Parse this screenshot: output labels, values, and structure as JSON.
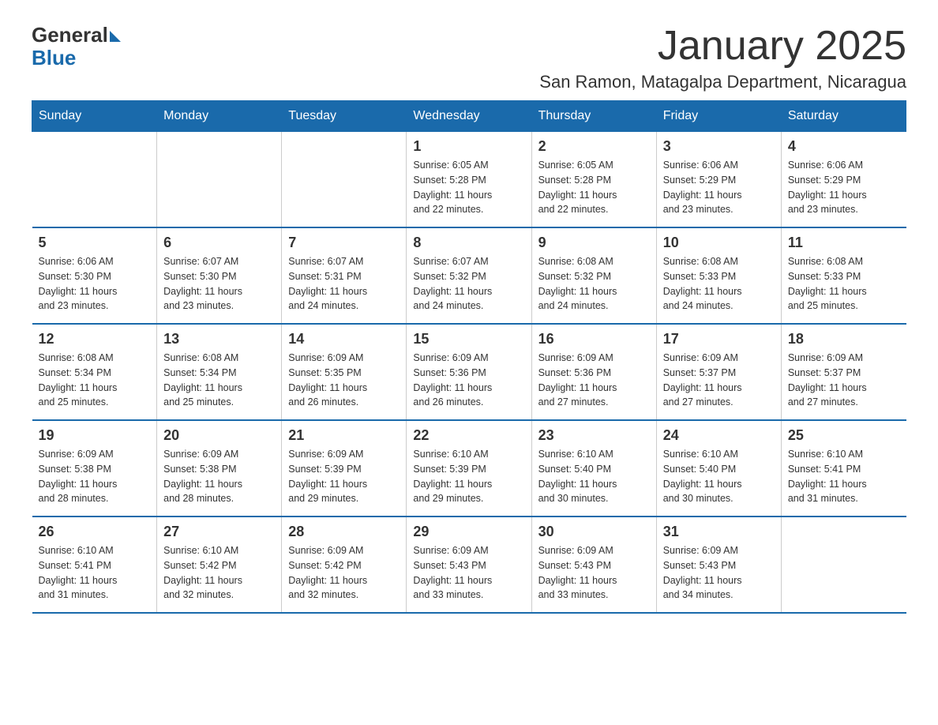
{
  "header": {
    "logo_general": "General",
    "logo_blue": "Blue",
    "month_year": "January 2025",
    "location": "San Ramon, Matagalpa Department, Nicaragua"
  },
  "days_of_week": [
    "Sunday",
    "Monday",
    "Tuesday",
    "Wednesday",
    "Thursday",
    "Friday",
    "Saturday"
  ],
  "weeks": [
    [
      {
        "day": "",
        "info": ""
      },
      {
        "day": "",
        "info": ""
      },
      {
        "day": "",
        "info": ""
      },
      {
        "day": "1",
        "info": "Sunrise: 6:05 AM\nSunset: 5:28 PM\nDaylight: 11 hours\nand 22 minutes."
      },
      {
        "day": "2",
        "info": "Sunrise: 6:05 AM\nSunset: 5:28 PM\nDaylight: 11 hours\nand 22 minutes."
      },
      {
        "day": "3",
        "info": "Sunrise: 6:06 AM\nSunset: 5:29 PM\nDaylight: 11 hours\nand 23 minutes."
      },
      {
        "day": "4",
        "info": "Sunrise: 6:06 AM\nSunset: 5:29 PM\nDaylight: 11 hours\nand 23 minutes."
      }
    ],
    [
      {
        "day": "5",
        "info": "Sunrise: 6:06 AM\nSunset: 5:30 PM\nDaylight: 11 hours\nand 23 minutes."
      },
      {
        "day": "6",
        "info": "Sunrise: 6:07 AM\nSunset: 5:30 PM\nDaylight: 11 hours\nand 23 minutes."
      },
      {
        "day": "7",
        "info": "Sunrise: 6:07 AM\nSunset: 5:31 PM\nDaylight: 11 hours\nand 24 minutes."
      },
      {
        "day": "8",
        "info": "Sunrise: 6:07 AM\nSunset: 5:32 PM\nDaylight: 11 hours\nand 24 minutes."
      },
      {
        "day": "9",
        "info": "Sunrise: 6:08 AM\nSunset: 5:32 PM\nDaylight: 11 hours\nand 24 minutes."
      },
      {
        "day": "10",
        "info": "Sunrise: 6:08 AM\nSunset: 5:33 PM\nDaylight: 11 hours\nand 24 minutes."
      },
      {
        "day": "11",
        "info": "Sunrise: 6:08 AM\nSunset: 5:33 PM\nDaylight: 11 hours\nand 25 minutes."
      }
    ],
    [
      {
        "day": "12",
        "info": "Sunrise: 6:08 AM\nSunset: 5:34 PM\nDaylight: 11 hours\nand 25 minutes."
      },
      {
        "day": "13",
        "info": "Sunrise: 6:08 AM\nSunset: 5:34 PM\nDaylight: 11 hours\nand 25 minutes."
      },
      {
        "day": "14",
        "info": "Sunrise: 6:09 AM\nSunset: 5:35 PM\nDaylight: 11 hours\nand 26 minutes."
      },
      {
        "day": "15",
        "info": "Sunrise: 6:09 AM\nSunset: 5:36 PM\nDaylight: 11 hours\nand 26 minutes."
      },
      {
        "day": "16",
        "info": "Sunrise: 6:09 AM\nSunset: 5:36 PM\nDaylight: 11 hours\nand 27 minutes."
      },
      {
        "day": "17",
        "info": "Sunrise: 6:09 AM\nSunset: 5:37 PM\nDaylight: 11 hours\nand 27 minutes."
      },
      {
        "day": "18",
        "info": "Sunrise: 6:09 AM\nSunset: 5:37 PM\nDaylight: 11 hours\nand 27 minutes."
      }
    ],
    [
      {
        "day": "19",
        "info": "Sunrise: 6:09 AM\nSunset: 5:38 PM\nDaylight: 11 hours\nand 28 minutes."
      },
      {
        "day": "20",
        "info": "Sunrise: 6:09 AM\nSunset: 5:38 PM\nDaylight: 11 hours\nand 28 minutes."
      },
      {
        "day": "21",
        "info": "Sunrise: 6:09 AM\nSunset: 5:39 PM\nDaylight: 11 hours\nand 29 minutes."
      },
      {
        "day": "22",
        "info": "Sunrise: 6:10 AM\nSunset: 5:39 PM\nDaylight: 11 hours\nand 29 minutes."
      },
      {
        "day": "23",
        "info": "Sunrise: 6:10 AM\nSunset: 5:40 PM\nDaylight: 11 hours\nand 30 minutes."
      },
      {
        "day": "24",
        "info": "Sunrise: 6:10 AM\nSunset: 5:40 PM\nDaylight: 11 hours\nand 30 minutes."
      },
      {
        "day": "25",
        "info": "Sunrise: 6:10 AM\nSunset: 5:41 PM\nDaylight: 11 hours\nand 31 minutes."
      }
    ],
    [
      {
        "day": "26",
        "info": "Sunrise: 6:10 AM\nSunset: 5:41 PM\nDaylight: 11 hours\nand 31 minutes."
      },
      {
        "day": "27",
        "info": "Sunrise: 6:10 AM\nSunset: 5:42 PM\nDaylight: 11 hours\nand 32 minutes."
      },
      {
        "day": "28",
        "info": "Sunrise: 6:09 AM\nSunset: 5:42 PM\nDaylight: 11 hours\nand 32 minutes."
      },
      {
        "day": "29",
        "info": "Sunrise: 6:09 AM\nSunset: 5:43 PM\nDaylight: 11 hours\nand 33 minutes."
      },
      {
        "day": "30",
        "info": "Sunrise: 6:09 AM\nSunset: 5:43 PM\nDaylight: 11 hours\nand 33 minutes."
      },
      {
        "day": "31",
        "info": "Sunrise: 6:09 AM\nSunset: 5:43 PM\nDaylight: 11 hours\nand 34 minutes."
      },
      {
        "day": "",
        "info": ""
      }
    ]
  ]
}
